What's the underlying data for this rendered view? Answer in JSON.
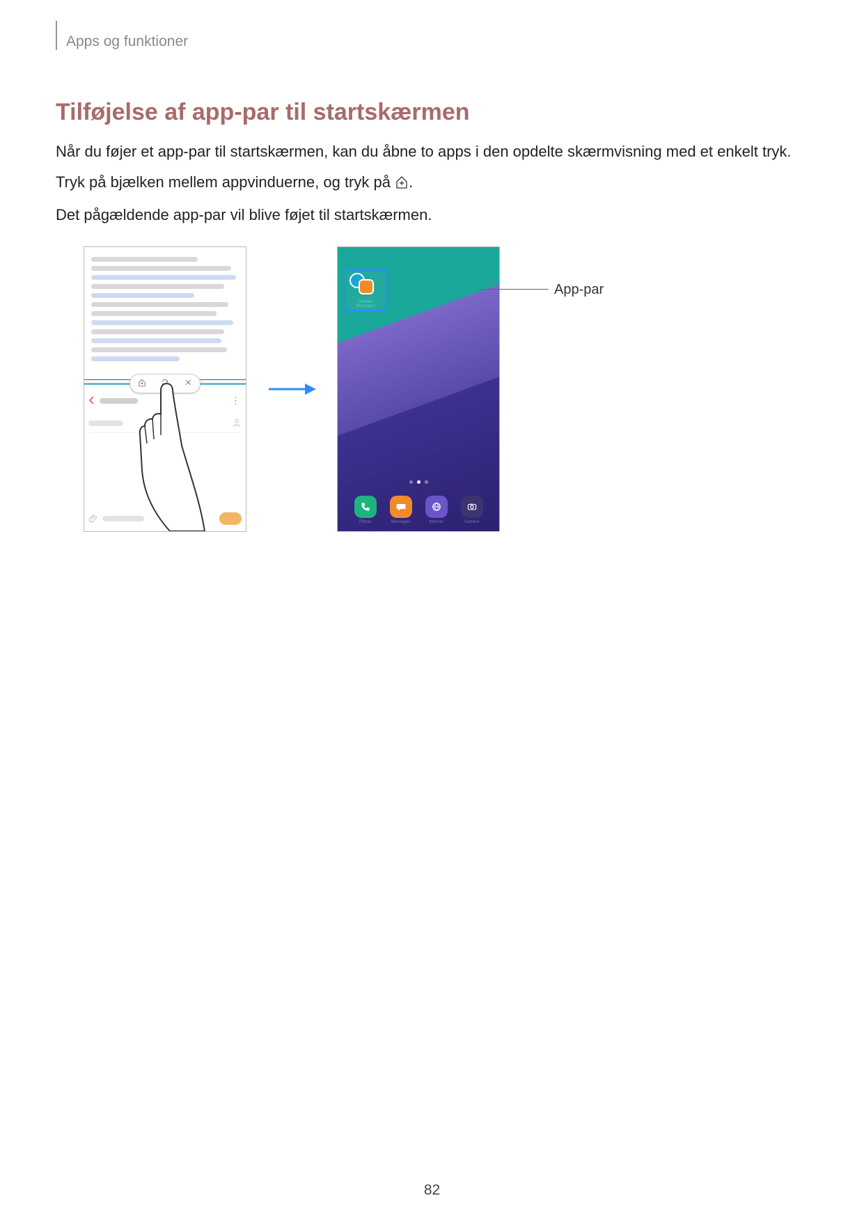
{
  "breadcrumb": "Apps og funktioner",
  "heading": "Tilføjelse af app-par til startskærmen",
  "paragraph1": "Når du føjer et app-par til startskærmen, kan du åbne to apps i den opdelte skærmvisning med et enkelt tryk.",
  "paragraph2_pre": "Tryk på bjælken mellem appvinduerne, og tryk på ",
  "paragraph2_post": ".",
  "paragraph3": "Det pågældende app-par vil blive føjet til startskærmen.",
  "callout": "App-par",
  "dock": {
    "phone": "Phone",
    "messages": "Messages",
    "internet": "Internet",
    "camera": "Camera"
  },
  "apppair_sublabels": {
    "line1": "Internet",
    "line2": "Messages"
  },
  "page_number": "82"
}
